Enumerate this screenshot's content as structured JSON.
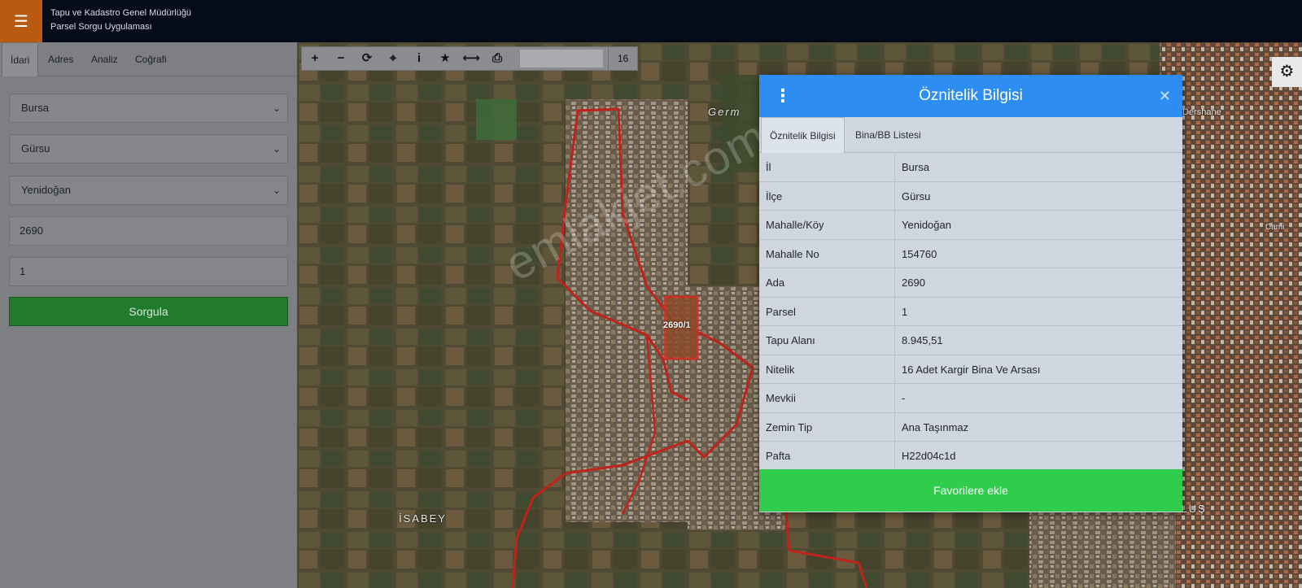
{
  "header": {
    "menu_icon": "hamburger-icon",
    "org_name": "Tapu ve Kadastro Genel Müdürlüğü",
    "app_name": "Parsel Sorgu Uygulaması"
  },
  "sidebar": {
    "tabs": [
      {
        "label": "İdari",
        "active": true
      },
      {
        "label": "Adres"
      },
      {
        "label": "Analiz"
      },
      {
        "label": "Coğrafi"
      }
    ],
    "province": "Bursa",
    "district": "Gürsu",
    "neighborhood": "Yenidoğan",
    "block": "2690",
    "parcel": "1",
    "query_button": "Sorgula"
  },
  "toolbar": {
    "tools": [
      "plus-icon",
      "minus-icon",
      "refresh-icon",
      "crosshair-icon",
      "info-icon",
      "star-icon",
      "measure-icon",
      "print-icon"
    ],
    "zoom_level": "16"
  },
  "map": {
    "parcel_label": "2690/1",
    "labels": [
      "Germ",
      "İSABEY",
      "KURTULUŞ",
      "Dershane",
      "Cami"
    ],
    "watermark": "emlakjet.com"
  },
  "popup": {
    "title": "Öznitelik Bilgisi",
    "tabs": [
      {
        "label": "Öznitelik Bilgisi",
        "active": true
      },
      {
        "label": "Bina/BB Listesi"
      }
    ],
    "rows": [
      {
        "key": "İl",
        "value": "Bursa"
      },
      {
        "key": "İlçe",
        "value": "Gürsu"
      },
      {
        "key": "Mahalle/Köy",
        "value": "Yenidoğan"
      },
      {
        "key": "Mahalle No",
        "value": "154760"
      },
      {
        "key": "Ada",
        "value": "2690"
      },
      {
        "key": "Parsel",
        "value": "1"
      },
      {
        "key": "Tapu Alanı",
        "value": "8.945,51"
      },
      {
        "key": "Nitelik",
        "value": "16 Adet Kargir Bina Ve Arsası"
      },
      {
        "key": "Mevkii",
        "value": "-"
      },
      {
        "key": "Zemin Tip",
        "value": "Ana Taşınmaz"
      },
      {
        "key": "Pafta",
        "value": "H22d04c1d"
      }
    ],
    "favorite_button": "Favorilere ekle"
  },
  "colors": {
    "header_bg": "#060b1a",
    "menu_accent": "#b85a12",
    "popup_header": "#2d8df0",
    "favorite_green": "#2fcc4d",
    "query_green": "#217a2d",
    "parcel_border": "#c0231c"
  }
}
